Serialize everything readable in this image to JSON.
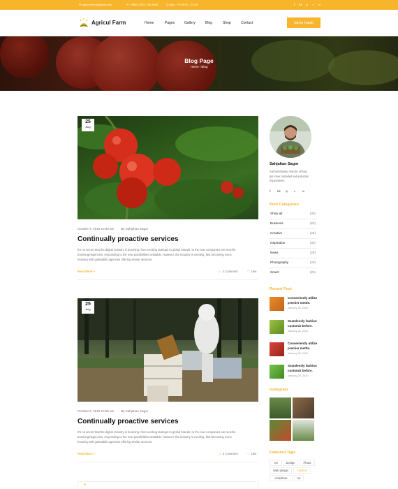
{
  "topbar": {
    "email": "AgricuFarm@gmail.com",
    "phone": "+88(0) 0291-746-4982",
    "hours": "Mon - Fri 09:00 - 18:00",
    "social": [
      "twitter-icon",
      "behance-icon",
      "instagram-icon",
      "vimeo-icon",
      "linkedin-icon"
    ]
  },
  "brand": {
    "name": "Agricul Farm",
    "accent": "#f7b52c"
  },
  "nav": {
    "items": [
      "Home",
      "Pages",
      "Gallery",
      "Blog",
      "Shop",
      "Contact"
    ],
    "cta": "Get in Touch"
  },
  "hero": {
    "title": "Blog Page",
    "breadcrumb": "Home / Blog"
  },
  "posts": [
    {
      "day": "25",
      "month": "Aug",
      "date": "October 9, 2019 10:59 am",
      "author": "By Sahjahan Sagor",
      "title": "Continually proactive services",
      "excerpt_lines": [
        "It's no secret that the digital industry is booming. from exciting startups to global brands, to the new companies are reachin",
        "boomingmsgencies, responding to the new possibilities available. however, the industry is exciting. fast becoming overc",
        "heaving with gobstabilit agencies offering similar services."
      ],
      "read_more": "Read More",
      "comments": "3 Comment",
      "likes": "Like"
    },
    {
      "day": "25",
      "month": "Aug",
      "date": "October 9, 2019 10:59 am",
      "author": "By Sahjahan Sagor",
      "title": "Continually proactive services",
      "excerpt_lines": [
        "It's no secret that the digital industry is booming. from exciting startups to global brands, to the new companies are reachin",
        "boomingmsgencies, responding to the new possibilities available. however, the industry is exciting. fast becoming overc",
        "heaving with gobstabilit agencies offering similar services."
      ],
      "read_more": "Read More",
      "comments": "3 Comment",
      "likes": "Like"
    }
  ],
  "quote_mark": "“",
  "sidebar": {
    "author_name": "Sahjahan Sagor",
    "author_bio": [
      "Authoritatively restore orthog",
      "ips inner installed led-industys",
      "imperatives."
    ],
    "social": [
      "twitter-icon",
      "behance-icon",
      "instagram-icon",
      "vimeo-icon",
      "linkedin-icon"
    ],
    "categories_title": "Post Categories",
    "categories": [
      {
        "name": "Show all",
        "count": "(30)"
      },
      {
        "name": "Business",
        "count": "(20)"
      },
      {
        "name": "Creative",
        "count": "(25)"
      },
      {
        "name": "Inspiration",
        "count": "(30)"
      },
      {
        "name": "News",
        "count": "(28)"
      },
      {
        "name": "Photography",
        "count": "(20)"
      },
      {
        "name": "Smart",
        "count": "(25)"
      }
    ],
    "recent_title": "Recent Post",
    "recent": [
      {
        "title": "Conveniently utilize premier mettle.",
        "date": "January 26, 2020"
      },
      {
        "title": "Seamlessly fashion customiz before.",
        "date": "January 26, 2020"
      },
      {
        "title": "Conveniently utilize premier mettle.",
        "date": "January 26, 2020"
      },
      {
        "title": "Seamlessly fashion customiz before.",
        "date": "January 26, 2020"
      }
    ],
    "instagram_title": "Instagram",
    "tags_title": "Featured Tags",
    "tags": [
      "Art",
      "Design",
      "Photo",
      "Web design",
      "Fashion",
      "Arkedture",
      "Ux"
    ],
    "active_tag": "Fashion"
  }
}
